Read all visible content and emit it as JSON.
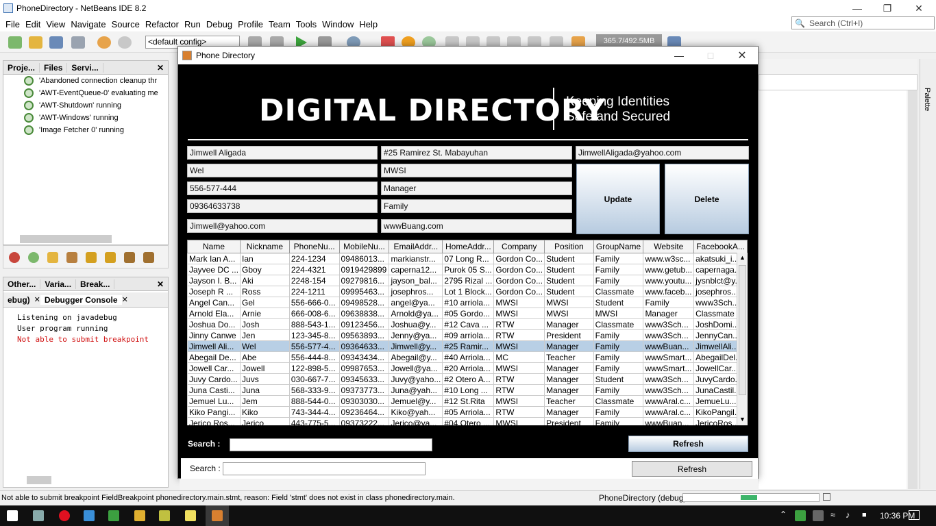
{
  "ide": {
    "title": "PhoneDirectory - NetBeans IDE 8.2",
    "menu": [
      "File",
      "Edit",
      "View",
      "Navigate",
      "Source",
      "Refactor",
      "Run",
      "Debug",
      "Profile",
      "Team",
      "Tools",
      "Window",
      "Help"
    ],
    "search_placeholder": "Search (Ctrl+I)",
    "config": "<default config>",
    "memory": "365.7/492.5MB",
    "left_tabs": [
      "Proje...",
      "Files",
      "Servi..."
    ],
    "threads": [
      "'Abandoned connection cleanup thr",
      "'AWT-EventQueue-0' evaluating me",
      "'AWT-Shutdown' running",
      "'AWT-Windows' running",
      "'Image Fetcher 0' running"
    ],
    "bottom_tabs": [
      "Other...",
      "Varia...",
      "Break..."
    ],
    "console_tabs": [
      "ebug)",
      "Debugger Console"
    ],
    "console_lines": [
      "Listening on javadebug",
      "User program running",
      "Not able to submit breakpoint"
    ],
    "palette": "Palette",
    "status_message": "Not able to submit breakpoint FieldBreakpoint phonedirectory.main.stmt, reason: Field 'stmt' does not exist in class phonedirectory.main.",
    "status_task": "PhoneDirectory (debug)",
    "clock": "10:36 PM"
  },
  "dialog": {
    "title": "Phone Directory",
    "brand": "DIGITAL DIRECTORY",
    "tagline1": "Keeping Identities",
    "tagline2": "Safe and Secured",
    "fields": {
      "name": "Jimwell Aligada",
      "nickname": "Wel",
      "phone": "556-577-444",
      "mobile": "09364633738",
      "email": "Jimwell@yahoo.com",
      "home": "#25 Ramirez St. Mabayuhan",
      "company": "MWSI",
      "position": "Manager",
      "group": "Family",
      "website": "wwwBuang.com",
      "facebook": "JimwellAligada@yahoo.com"
    },
    "update_label": "Update",
    "delete_label": "Delete",
    "search_label": "Search :",
    "refresh_label": "Refresh",
    "columns": [
      "Name",
      "Nickname",
      "PhoneNu...",
      "MobileNu...",
      "EmailAddr...",
      "HomeAddr...",
      "Company",
      "Position",
      "GroupName",
      "Website",
      "FacebookA..."
    ],
    "rows": [
      [
        "Mark Ian A...",
        "Ian",
        "224-1234",
        "09486013...",
        "markianstr...",
        "07 Long R...",
        "Gordon Co...",
        "Student",
        "Family",
        "www.w3sc...",
        "akatsuki_i..."
      ],
      [
        "Jayvee DC ...",
        "Gboy",
        "224-4321",
        "0919429899",
        "caperna12...",
        "Purok 05 S...",
        "Gordon Co...",
        "Student",
        "Family",
        "www.getub...",
        "capernaga..."
      ],
      [
        "Jayson I. B...",
        "Aki",
        "2248-154",
        "09279816...",
        "jayson_bal...",
        "2795 Rizal ...",
        "Gordon Co...",
        "Student",
        "Family",
        "www.youtu...",
        "jysnblct@y..."
      ],
      [
        "Joseph R ...",
        "Ross",
        "224-1211",
        "09995463...",
        "josephros...",
        "Lot 1 Block...",
        "Gordon Co...",
        "Student",
        "Classmate",
        "www.faceb...",
        "josephros..."
      ],
      [
        "Angel Can...",
        "Gel",
        "556-666-0...",
        "09498528...",
        "angel@ya...",
        "#10 arriola...",
        "MWSI",
        "MWSI",
        "Student",
        "Family",
        "www3Sch..."
      ],
      [
        "Arnold Ela...",
        "Arnie",
        "666-008-6...",
        "09638838...",
        "Arnold@ya...",
        "#05 Gordo...",
        "MWSI",
        "MWSI",
        "MWSI",
        "Manager",
        "Classmate"
      ],
      [
        "Joshua Do...",
        "Josh",
        "888-543-1...",
        "09123456...",
        "Joshua@y...",
        "#12 Cava ...",
        "RTW",
        "Manager",
        "Classmate",
        "www3Sch...",
        "JoshDomi..."
      ],
      [
        "Jinny Canwe",
        "Jen",
        "123-345-8...",
        "09563893...",
        "Jenny@ya...",
        "#09 arriola...",
        "RTW",
        "President",
        "Family",
        "www3Sch...",
        "JennyCan..."
      ],
      [
        "Jimwell Ali...",
        "Wel",
        "556-577-4...",
        "09364633...",
        "Jimwell@y...",
        "#25 Ramir...",
        "MWSI",
        "Manager",
        "Family",
        "wwwBuan...",
        "JimwellAli..."
      ],
      [
        "Abegail De...",
        "Abe",
        "556-444-8...",
        "09343434...",
        "Abegail@y...",
        "#40 Arriola...",
        "MC",
        "Teacher",
        "Family",
        "wwwSmart...",
        "AbegailDel..."
      ],
      [
        "Jowell Car...",
        "Jowell",
        "122-898-5...",
        "09987653...",
        "Jowell@ya...",
        "#20 Arriola...",
        "MWSI",
        "Manager",
        "Family",
        "wwwSmart...",
        "JowellCar..."
      ],
      [
        "Juvy Cardo...",
        "Juvs",
        "030-667-7...",
        "09345633...",
        "Juvy@yaho...",
        "#2 Otero A...",
        "RTW",
        "Manager",
        "Student",
        "www3Sch...",
        "JuvyCardo..."
      ],
      [
        "Juna Casti...",
        "Juna",
        "568-333-9...",
        "09373773...",
        "Juna@yah...",
        "#10 Long ...",
        "RTW",
        "Manager",
        "Family",
        "www3Sch...",
        "JunaCastil..."
      ],
      [
        "Jemuel Lu...",
        "Jem",
        "888-544-0...",
        "09303030...",
        "Jemuel@y...",
        "#12 St.Rita",
        "MWSI",
        "Teacher",
        "Classmate",
        "wwwAral.c...",
        "JemueLu..."
      ],
      [
        "Kiko Pangi...",
        "Kiko",
        "743-344-4...",
        "09236464...",
        "Kiko@yah...",
        "#05 Arriola...",
        "RTW",
        "Manager",
        "Family",
        "wwwAral.c...",
        "KikoPangil..."
      ],
      [
        "Jerico Ros...",
        "Jerico",
        "443-775-5...",
        "09373222...",
        "Jerico@ya...",
        "#04 Otero ...",
        "MWSI",
        "President",
        "Family",
        "wwwBuan...",
        "JericoRos..."
      ]
    ],
    "selected_row": 8
  }
}
